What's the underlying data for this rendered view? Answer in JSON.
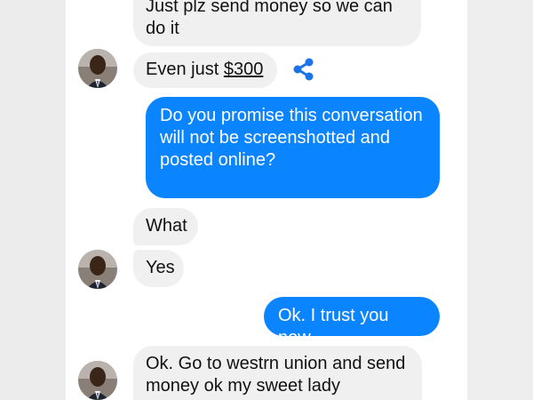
{
  "messages": [
    {
      "id": "m1",
      "from": "them",
      "text": "Just plz send money so we can do it"
    },
    {
      "id": "m2",
      "from": "them",
      "text_prefix": "Even just ",
      "amount": "$300",
      "has_avatar": true,
      "icon": "share-icon"
    },
    {
      "id": "m3",
      "from": "me",
      "text": "Do you promise this conversation will not be screenshotted and posted online?"
    },
    {
      "id": "m4",
      "from": "them",
      "text": "What"
    },
    {
      "id": "m5",
      "from": "them",
      "text": "Yes",
      "has_avatar": true
    },
    {
      "id": "m6",
      "from": "me",
      "text": "Ok. I trust you now"
    },
    {
      "id": "m7",
      "from": "them",
      "text": "Ok. Go to westrn union and send money ok my sweet lady",
      "has_avatar": true
    }
  ],
  "colors": {
    "outgoing_bubble": "#0b84ff",
    "incoming_bubble": "#f1f0f0",
    "share_icon": "#1a73e8"
  }
}
